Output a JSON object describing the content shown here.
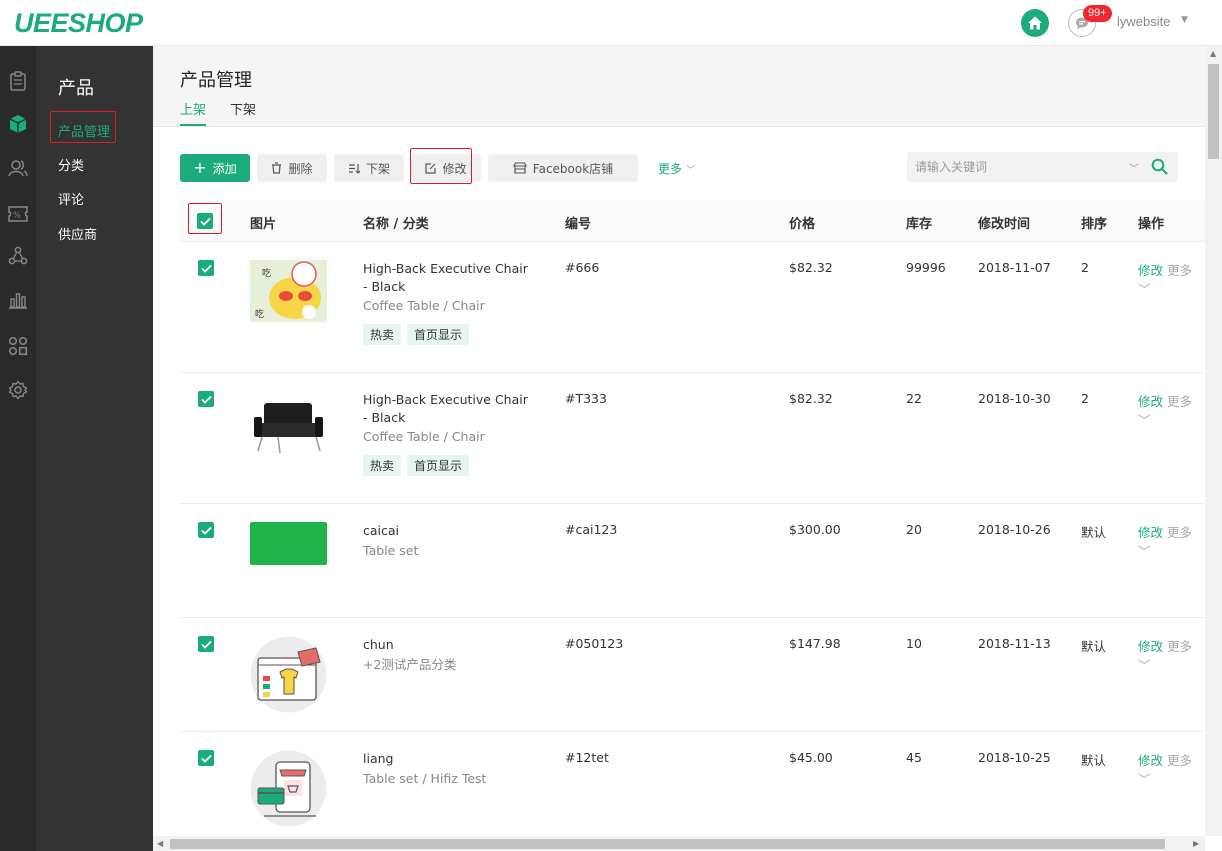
{
  "header": {
    "logo": "UEESHOP",
    "badge": "99+",
    "user": "lywebsite"
  },
  "rail": {
    "icons": [
      "orders-icon",
      "products-icon",
      "users-icon",
      "promotions-icon",
      "share-icon",
      "stats-icon",
      "apps-icon",
      "settings-icon"
    ],
    "active": "products-icon"
  },
  "subnav": {
    "title": "产品",
    "items": [
      "产品管理",
      "分类",
      "评论",
      "供应商"
    ]
  },
  "page": {
    "title": "产品管理",
    "tabs": [
      "上架",
      "下架"
    ]
  },
  "toolbar": {
    "add": "添加",
    "delete": "删除",
    "offline": "下架",
    "edit": "修改",
    "facebook": "Facebook店铺",
    "more": "更多",
    "search_placeholder": "请输入关键词"
  },
  "table": {
    "headers": [
      "图片",
      "名称 / 分类",
      "编号",
      "价格",
      "库存",
      "修改时间",
      "排序",
      "操作"
    ],
    "rows": [
      {
        "name": "High-Back Executive Chair - Black",
        "category": "Coffee Table / Chair",
        "tags": [
          "热卖",
          "首页显示"
        ],
        "sku": "#666",
        "price": "$82.32",
        "stock": "99996",
        "date": "2018-11-07",
        "sort": "2",
        "edit": "修改",
        "more": "更多",
        "image": "cartoon-cat-image"
      },
      {
        "name": "High-Back Executive Chair - Black",
        "category": "Coffee Table / Chair",
        "tags": [
          "热卖",
          "首页显示"
        ],
        "sku": "#T333",
        "price": "$82.32",
        "stock": "22",
        "date": "2018-10-30",
        "sort": "2",
        "edit": "修改",
        "more": "更多",
        "image": "black-chair-image"
      },
      {
        "name": "caicai",
        "category": "Table set",
        "tags": [],
        "sku": "#cai123",
        "price": "$300.00",
        "stock": "20",
        "date": "2018-10-26",
        "sort": "默认",
        "edit": "修改",
        "more": "更多",
        "image": "green-swatch-image"
      },
      {
        "name": "chun",
        "category": "+2测试产品分类",
        "tags": [],
        "sku": "#050123",
        "price": "$147.98",
        "stock": "10",
        "date": "2018-11-13",
        "sort": "默认",
        "edit": "修改",
        "more": "更多",
        "image": "shirt-illustration-image"
      },
      {
        "name": "liang",
        "category": "Table set / Hifiz Test",
        "tags": [],
        "sku": "#12tet",
        "price": "$45.00",
        "stock": "45",
        "date": "2018-10-25",
        "sort": "默认",
        "edit": "修改",
        "more": "更多",
        "image": "shop-illustration-image"
      }
    ]
  },
  "colors": {
    "accent": "#1bab7c",
    "highlight": "#d81e26",
    "sidebar": "#333333",
    "rail": "#2a2a2a"
  }
}
